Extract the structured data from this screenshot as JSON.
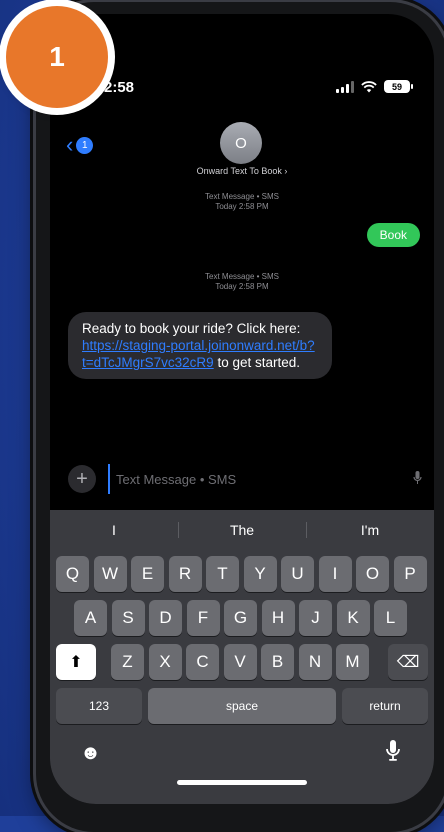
{
  "step_badge": "1",
  "status": {
    "time": "2:58",
    "battery": "59"
  },
  "header": {
    "back_count": "1",
    "avatar_initial": "O",
    "contact_name": "Onward Text To Book ›"
  },
  "thread": {
    "meta1_line1": "Text Message • SMS",
    "meta1_line2": "Today 2:58 PM",
    "outgoing": "Book",
    "meta2_line1": "Text Message • SMS",
    "meta2_line2": "Today 2:58 PM",
    "incoming_prefix": "Ready to book your ride? Click here: ",
    "incoming_link": "https://staging-portal.joinonward.net/b?t=dTcJMgrS7vc32cR9",
    "incoming_suffix": " to get started."
  },
  "compose": {
    "placeholder": "Text Message • SMS",
    "plus": "+"
  },
  "keyboard": {
    "suggestions": [
      "I",
      "The",
      "I'm"
    ],
    "row1": [
      "Q",
      "W",
      "E",
      "R",
      "T",
      "Y",
      "U",
      "I",
      "O",
      "P"
    ],
    "row2": [
      "A",
      "S",
      "D",
      "F",
      "G",
      "H",
      "J",
      "K",
      "L"
    ],
    "row3": [
      "Z",
      "X",
      "C",
      "V",
      "B",
      "N",
      "M"
    ],
    "shift": "⬆",
    "backspace": "⌫",
    "numbers": "123",
    "space": "space",
    "return": "return",
    "emoji_icon": "☻",
    "mic_icon": "🎙"
  },
  "colors": {
    "background": "#1f3f9a",
    "badge": "#e8772a",
    "imessage_green": "#32c759",
    "link_blue": "#2f7dff"
  }
}
